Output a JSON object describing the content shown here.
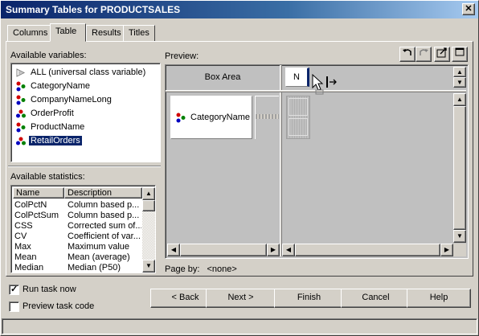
{
  "window": {
    "title": "Summary Tables for PRODUCTSALES",
    "close_glyph": "✕"
  },
  "tabs": [
    {
      "label": "Columns"
    },
    {
      "label": "Table"
    },
    {
      "label": "Results"
    },
    {
      "label": "Titles"
    }
  ],
  "variables": {
    "heading": "Available variables:",
    "items": [
      {
        "label": "ALL (universal class variable)",
        "icon": "universal-icon"
      },
      {
        "label": "CategoryName",
        "icon": "class-variable-icon"
      },
      {
        "label": "CompanyNameLong",
        "icon": "class-variable-icon"
      },
      {
        "label": "OrderProfit",
        "icon": "analysis-variable-icon"
      },
      {
        "label": "ProductName",
        "icon": "class-variable-icon"
      },
      {
        "label": "RetailOrders",
        "icon": "analysis-variable-icon"
      }
    ]
  },
  "statistics": {
    "heading": "Available statistics:",
    "columns": [
      "Name",
      "Description"
    ],
    "rows": [
      [
        "ColPctN",
        "Column based p..."
      ],
      [
        "ColPctSum",
        "Column based p..."
      ],
      [
        "CSS",
        "Corrected sum of..."
      ],
      [
        "CV",
        "Coefficient of var..."
      ],
      [
        "Max",
        "Maximum value"
      ],
      [
        "Mean",
        "Mean (average)"
      ],
      [
        "Median",
        "Median (P50)"
      ]
    ]
  },
  "preview": {
    "heading": "Preview:",
    "box_area": "Box Area",
    "column_stat": "N",
    "row_class": "CategoryName",
    "page_by_label": "Page by:",
    "page_by_value": "<none>"
  },
  "options": {
    "run_task_now": {
      "label": "Run task now",
      "checked": true
    },
    "preview_task_code": {
      "label": "Preview task code",
      "checked": false
    }
  },
  "buttons": {
    "back": "< Back",
    "next": "Next >",
    "finish": "Finish",
    "cancel": "Cancel",
    "help": "Help"
  },
  "colors": {
    "title_start": "#0a246a",
    "title_end": "#a6caf0",
    "selection": "#0a246a",
    "face": "#d4d0c8"
  }
}
